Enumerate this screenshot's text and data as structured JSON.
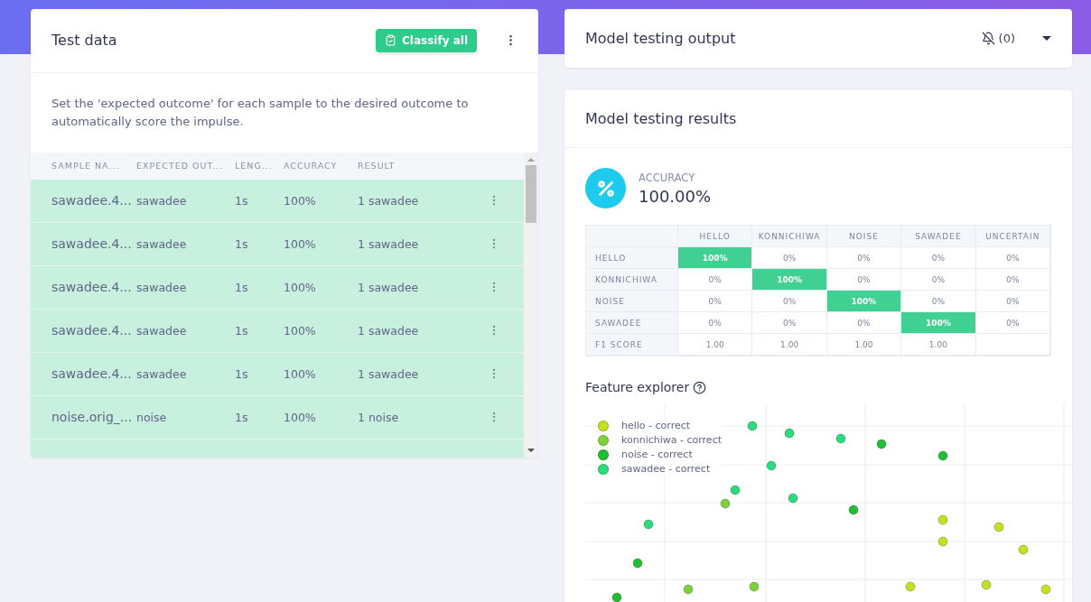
{
  "test_data": {
    "title": "Test data",
    "classify_button": "Classify all",
    "description": "Set the 'expected outcome' for each sample to the desired outcome to automatically score the impulse.",
    "columns": [
      "SAMPLE NA...",
      "EXPECTED OUT...",
      "LENG...",
      "ACCURACY",
      "RESULT"
    ],
    "rows": [
      {
        "cells": [
          "sawadee.4...",
          "sawadee",
          "1s",
          "100%",
          "1 sawadee"
        ],
        "correct": true
      },
      {
        "cells": [
          "sawadee.4...",
          "sawadee",
          "1s",
          "100%",
          "1 sawadee"
        ],
        "correct": true
      },
      {
        "cells": [
          "sawadee.4...",
          "sawadee",
          "1s",
          "100%",
          "1 sawadee"
        ],
        "correct": true
      },
      {
        "cells": [
          "sawadee.4...",
          "sawadee",
          "1s",
          "100%",
          "1 sawadee"
        ],
        "correct": true
      },
      {
        "cells": [
          "sawadee.4...",
          "sawadee",
          "1s",
          "100%",
          "1 sawadee"
        ],
        "correct": true
      },
      {
        "cells": [
          "noise.orig_...",
          "noise",
          "1s",
          "100%",
          "1 noise"
        ],
        "correct": true
      }
    ]
  },
  "output": {
    "title": "Model testing output",
    "notifications": "(0)"
  },
  "results": {
    "title": "Model testing results",
    "accuracy_label": "ACCURACY",
    "accuracy_value": "100.00%",
    "matrix": {
      "columns": [
        "HELLO",
        "KONNICHIWA",
        "NOISE",
        "SAWADEE",
        "UNCERTAIN"
      ],
      "rows": [
        {
          "label": "HELLO",
          "cells": [
            {
              "text": "100%",
              "highlight": true
            },
            {
              "text": "0%",
              "highlight": false
            },
            {
              "text": "0%",
              "highlight": false
            },
            {
              "text": "0%",
              "highlight": false
            },
            {
              "text": "0%",
              "highlight": false
            }
          ]
        },
        {
          "label": "KONNICHIWA",
          "cells": [
            {
              "text": "0%",
              "highlight": false
            },
            {
              "text": "100%",
              "highlight": true
            },
            {
              "text": "0%",
              "highlight": false
            },
            {
              "text": "0%",
              "highlight": false
            },
            {
              "text": "0%",
              "highlight": false
            }
          ]
        },
        {
          "label": "NOISE",
          "cells": [
            {
              "text": "0%",
              "highlight": false
            },
            {
              "text": "0%",
              "highlight": false
            },
            {
              "text": "100%",
              "highlight": true
            },
            {
              "text": "0%",
              "highlight": false
            },
            {
              "text": "0%",
              "highlight": false
            }
          ]
        },
        {
          "label": "SAWADEE",
          "cells": [
            {
              "text": "0%",
              "highlight": false
            },
            {
              "text": "0%",
              "highlight": false
            },
            {
              "text": "0%",
              "highlight": false
            },
            {
              "text": "100%",
              "highlight": true
            },
            {
              "text": "0%",
              "highlight": false
            }
          ]
        },
        {
          "label": "F1 SCORE",
          "cells": [
            {
              "text": "1.00",
              "highlight": false
            },
            {
              "text": "1.00",
              "highlight": false
            },
            {
              "text": "1.00",
              "highlight": false
            },
            {
              "text": "1.00",
              "highlight": false
            }
          ]
        }
      ]
    },
    "feature_explorer": {
      "title": "Feature explorer",
      "legend": [
        {
          "label": "hello - correct",
          "color": "#c5e01f"
        },
        {
          "label": "konnichiwa - correct",
          "color": "#7fd13b"
        },
        {
          "label": "noise - correct",
          "color": "#1fbf2f"
        },
        {
          "label": "sawadee - correct",
          "color": "#2bdc7f"
        }
      ]
    }
  }
}
